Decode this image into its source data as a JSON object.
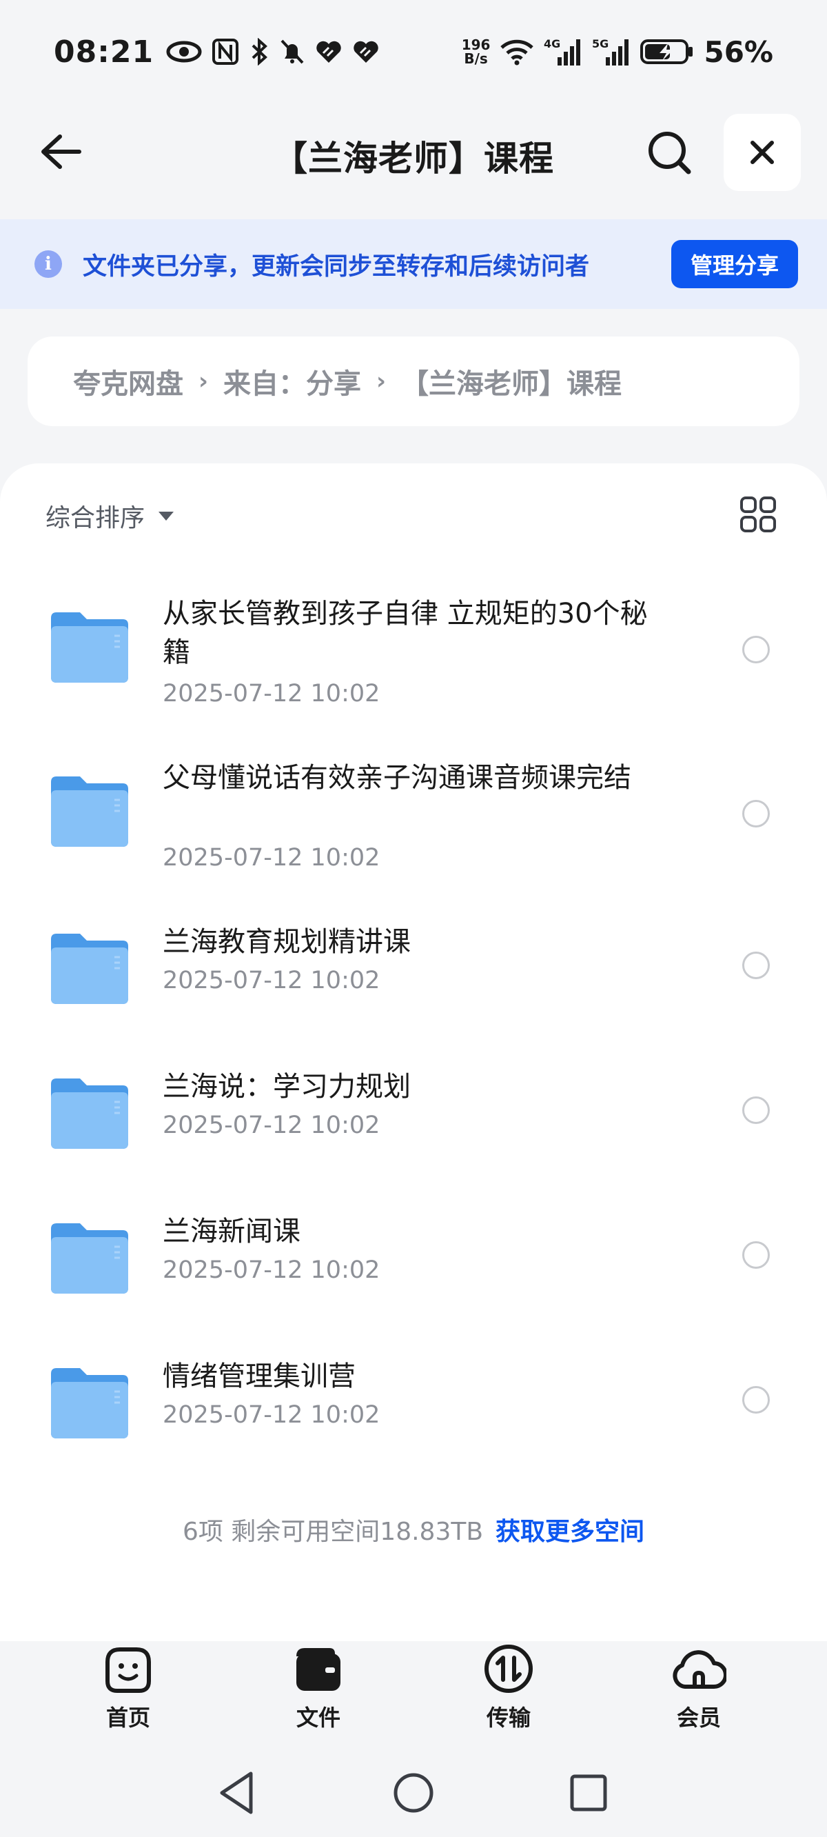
{
  "status_bar": {
    "time": "08:21",
    "net_speed_value": "196",
    "net_speed_unit": "B/s",
    "network_1": "4G",
    "network_2": "5G",
    "battery": "56%"
  },
  "header": {
    "title": "【兰海老师】课程"
  },
  "share_banner": {
    "message": "文件夹已分享，更新会同步至转存和后续访问者",
    "button_label": "管理分享"
  },
  "breadcrumb": {
    "items": [
      "夸克网盘",
      "来自：分享",
      "【兰海老师】课程"
    ]
  },
  "sort": {
    "label": "综合排序"
  },
  "files": [
    {
      "name": "从家长管教到孩子自律 立规矩的30个秘籍",
      "date": "2025-07-12 10:02"
    },
    {
      "name": "父母懂说话有效亲子沟通课音频课完结",
      "date": "2025-07-12 10:02"
    },
    {
      "name": "兰海教育规划精讲课",
      "date": "2025-07-12 10:02"
    },
    {
      "name": "兰海说：学习力规划",
      "date": "2025-07-12 10:02"
    },
    {
      "name": "兰海新闻课",
      "date": "2025-07-12 10:02"
    },
    {
      "name": "情绪管理集训营",
      "date": "2025-07-12 10:02"
    }
  ],
  "footer": {
    "summary": "6项 剩余可用空间18.83TB",
    "link": "获取更多空间"
  },
  "tabs": [
    {
      "label": "首页",
      "icon": "smiley-home-icon"
    },
    {
      "label": "文件",
      "icon": "wallet-file-icon"
    },
    {
      "label": "传输",
      "icon": "transfer-icon"
    },
    {
      "label": "会员",
      "icon": "cloud-member-icon"
    }
  ],
  "colors": {
    "accent": "#0d57f0",
    "banner_bg": "#e8eefc",
    "folder": "#6fb3f5"
  }
}
